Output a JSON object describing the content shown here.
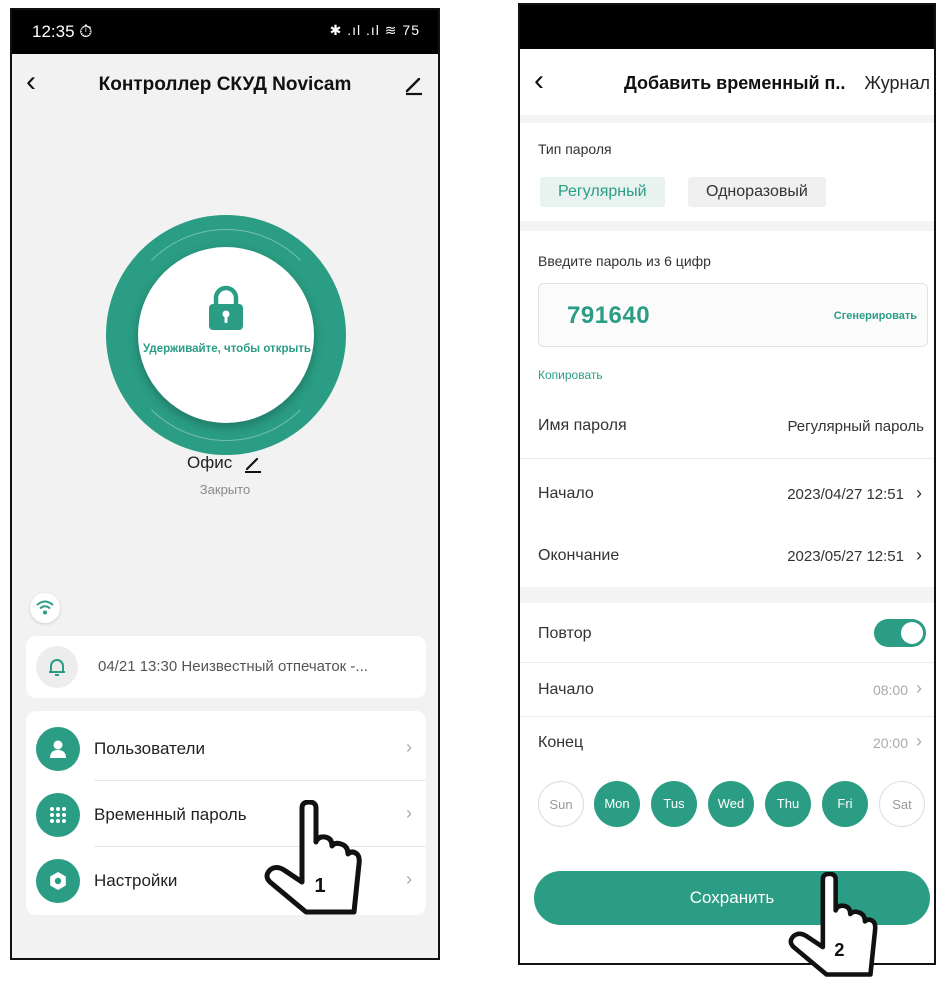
{
  "phone1": {
    "status": {
      "time": "12:35 ⏱",
      "icons": "✱ .ıl .ıl ≋ 75"
    },
    "title": "Контроллер СКУД Novicam",
    "hold_text": "Удерживайте, чтобы открыть",
    "door_name": "Офис",
    "door_state": "Закрыто",
    "notification": "04/21 13:30  Неизвестный отпечаток -...",
    "menu": [
      {
        "label": "Пользователи"
      },
      {
        "label": "Временный пароль"
      },
      {
        "label": "Настройки"
      }
    ],
    "pointer_number": "1"
  },
  "phone2": {
    "title": "Добавить временный п..",
    "journal": "Журнал",
    "type_label": "Тип пароля",
    "type_regular": "Регулярный",
    "type_once": "Одноразовый",
    "pass_prompt": "Введите пароль из 6 цифр",
    "pass_value": "791640",
    "generate": "Сгенерировать",
    "copy": "Копировать",
    "name_label": "Имя пароля",
    "name_value": "Регулярный пароль",
    "start_label": "Начало",
    "start_value": "2023/04/27 12:51",
    "end_label": "Окончание",
    "end_value": "2023/05/27 12:51",
    "repeat_label": "Повтор",
    "repeat_on": true,
    "repeat_start_label": "Начало",
    "repeat_start_value": "08:00",
    "repeat_end_label": "Конец",
    "repeat_end_value": "20:00",
    "days": [
      "Sun",
      "Mon",
      "Tus",
      "Wed",
      "Thu",
      "Fri",
      "Sat"
    ],
    "save": "Сохранить",
    "pointer_number": "2"
  },
  "colors": {
    "accent": "#2a9d84"
  }
}
